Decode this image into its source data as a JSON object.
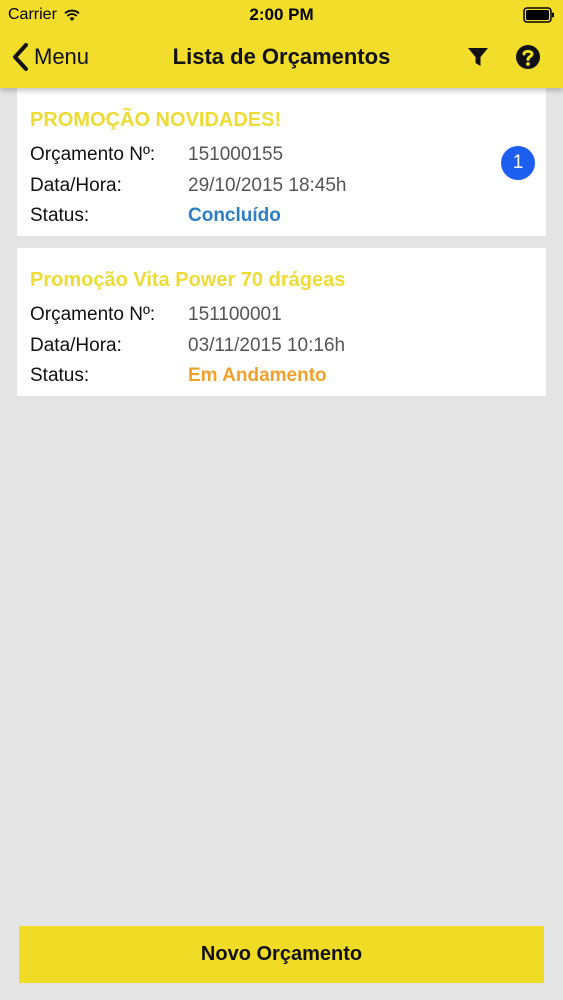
{
  "status_bar": {
    "carrier": "Carrier",
    "time": "2:00 PM",
    "icons": [
      "wifi-icon",
      "battery-icon"
    ]
  },
  "nav": {
    "back_label": "Menu",
    "title": "Lista de Orçamentos",
    "icons": [
      "chevron-left-icon",
      "filter-icon",
      "help-icon"
    ]
  },
  "quotes": [
    {
      "title": "PROMOÇÃO NOVIDADES!",
      "number_label": "Orçamento Nº:",
      "number": "151000155",
      "date_label": "Data/Hora:",
      "date": "29/10/2015 18:45h",
      "status_label": "Status:",
      "status": "Concluído",
      "status_color": "#2c7fc3",
      "badge": "1"
    },
    {
      "title": "Promoção Vita Power 70 drágeas",
      "number_label": "Orçamento Nº:",
      "number": "151100001",
      "date_label": "Data/Hora:",
      "date": "03/11/2015 10:16h",
      "status_label": "Status:",
      "status": "Em Andamento",
      "status_color": "#f0a12a"
    }
  ],
  "footer": {
    "new_button_label": "Novo Orçamento"
  },
  "colors": {
    "accent": "#f2de2a",
    "title_yellow": "#eedc35",
    "badge_blue": "#1c5ff0",
    "background": "#e5e5e5"
  }
}
